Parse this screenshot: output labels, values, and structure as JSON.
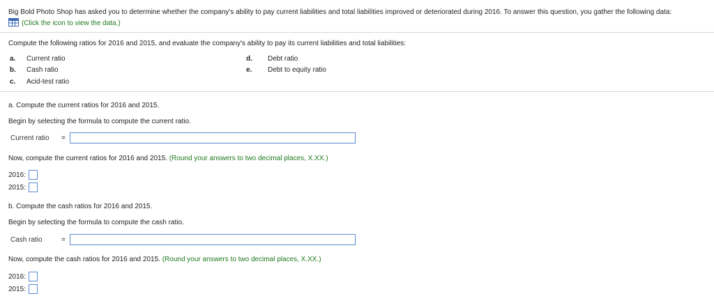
{
  "intro": {
    "text": "Big Bold Photo Shop has asked you to determine whether the company's ability to pay current liabilities and total liabilities improved or deteriorated during 2016. To answer this question, you gather the following data:",
    "data_link": "(Click the icon to view the data.)"
  },
  "instructions": "Compute the following ratios for 2016 and 2015, and evaluate the company's ability to pay its current liabilities and total liabilities:",
  "ratios": [
    {
      "letter": "a.",
      "label": "Current ratio"
    },
    {
      "letter": "b.",
      "label": "Cash ratio"
    },
    {
      "letter": "c.",
      "label": "Acid-test ratio"
    },
    {
      "letter": "d.",
      "label": "Debt ratio"
    },
    {
      "letter": "e.",
      "label": "Debt to equity ratio"
    }
  ],
  "part_a": {
    "heading": "a. Compute the current ratios for 2016 and 2015.",
    "begin": "Begin by selecting the formula to compute the current ratio.",
    "formula_label": "Current ratio",
    "equals": "=",
    "now": "Now, compute the current ratios for 2016 and 2015.",
    "round_note": "(Round your answers to two decimal places, X.XX.)",
    "year1": "2016:",
    "year2": "2015:"
  },
  "part_b": {
    "heading": "b. Compute the cash ratios for 2016 and 2015.",
    "begin": "Begin by selecting the formula to compute the cash ratio.",
    "formula_label": "Cash ratio",
    "equals": "=",
    "now": "Now, compute the cash ratios for 2016 and 2015.",
    "round_note": "(Round your answers to two decimal places, X.XX.)",
    "year1": "2016:",
    "year2": "2015:"
  },
  "icons": {
    "data_icon": "table-grid-icon"
  },
  "colors": {
    "link_green": "#1e7a1e",
    "input_border": "#5b8bd0",
    "icon_blue": "#3a6ab4"
  }
}
